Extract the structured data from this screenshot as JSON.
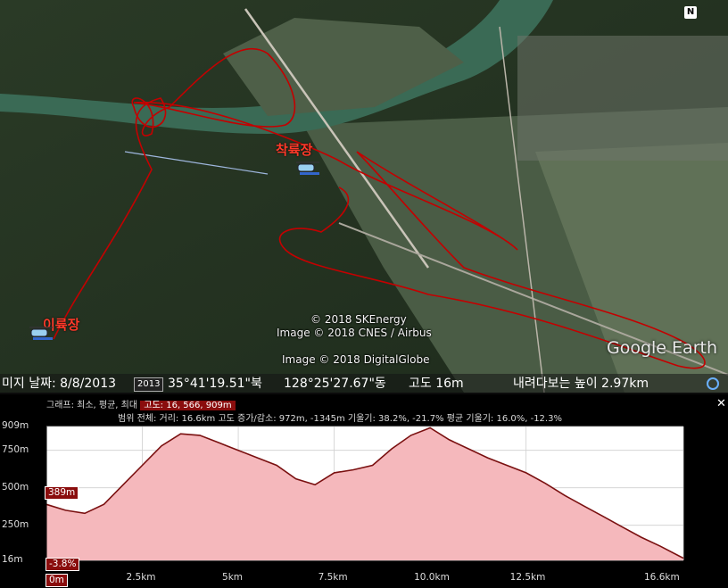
{
  "map": {
    "takeoff_label": "이륙장",
    "landing_label": "착륙장",
    "copyright_lines": [
      "© 2018 SKEnergy",
      "Image © 2018 CNES / Airbus",
      "Image © 2018 DigitalGlobe"
    ],
    "logo": "Google Earth",
    "north_label": "N",
    "colors": {
      "track": "#c40000",
      "terrain": "#2c3d28",
      "river": "#3a6a55"
    }
  },
  "status": {
    "date": "미지 날짜: 8/8/2013",
    "year_chip": "2013",
    "lat": "35°41'19.51\"북",
    "lon": "128°25'27.67\"동",
    "elev": "고도    16m",
    "eye": "내려다보는 높이    2.97km"
  },
  "profile": {
    "graph_line_prefix": "그래프: 최소, 평균, 최대",
    "graph_line_value": "고도: 16, 566, 909m",
    "range_line": "범위 전체: 거리: 16.6km 고도 증가/감소: 972m, -1345m  기울기: 38.2%, -21.7%  평균 기울기: 16.0%, -12.3%",
    "close_label": "✕",
    "cursor_elev_badge": "389m",
    "cursor_slope_badge": "-3.8%",
    "start_badge": "0m"
  },
  "chart_data": {
    "type": "area",
    "title": "",
    "xlabel": "",
    "ylabel": "",
    "xlim": [
      0,
      16.6
    ],
    "ylim": [
      16,
      909
    ],
    "ytick_labels": [
      "909m",
      "750m",
      "500m",
      "250m",
      "16m"
    ],
    "ytick_values": [
      909,
      750,
      500,
      250,
      16
    ],
    "xtick_labels": [
      "2.5km",
      "5km",
      "7.5km",
      "10.0km",
      "12.5km",
      "16.6km"
    ],
    "xtick_values": [
      2.5,
      5,
      7.5,
      10,
      12.5,
      16.6
    ],
    "x": [
      0,
      0.5,
      1.0,
      1.5,
      2.0,
      2.5,
      3.0,
      3.5,
      4.0,
      4.5,
      5.0,
      5.5,
      6.0,
      6.5,
      7.0,
      7.5,
      8.0,
      8.5,
      9.0,
      9.5,
      10.0,
      10.5,
      11.0,
      11.5,
      12.0,
      12.5,
      13.0,
      13.5,
      14.0,
      14.5,
      15.0,
      15.5,
      16.0,
      16.6
    ],
    "y": [
      389,
      350,
      330,
      390,
      520,
      650,
      780,
      860,
      850,
      800,
      750,
      700,
      650,
      560,
      520,
      600,
      620,
      650,
      760,
      850,
      900,
      820,
      760,
      700,
      650,
      600,
      530,
      450,
      380,
      310,
      240,
      170,
      110,
      30
    ],
    "fill_color": "#f5b8bc",
    "line_color": "#7a1010",
    "grid": true
  }
}
